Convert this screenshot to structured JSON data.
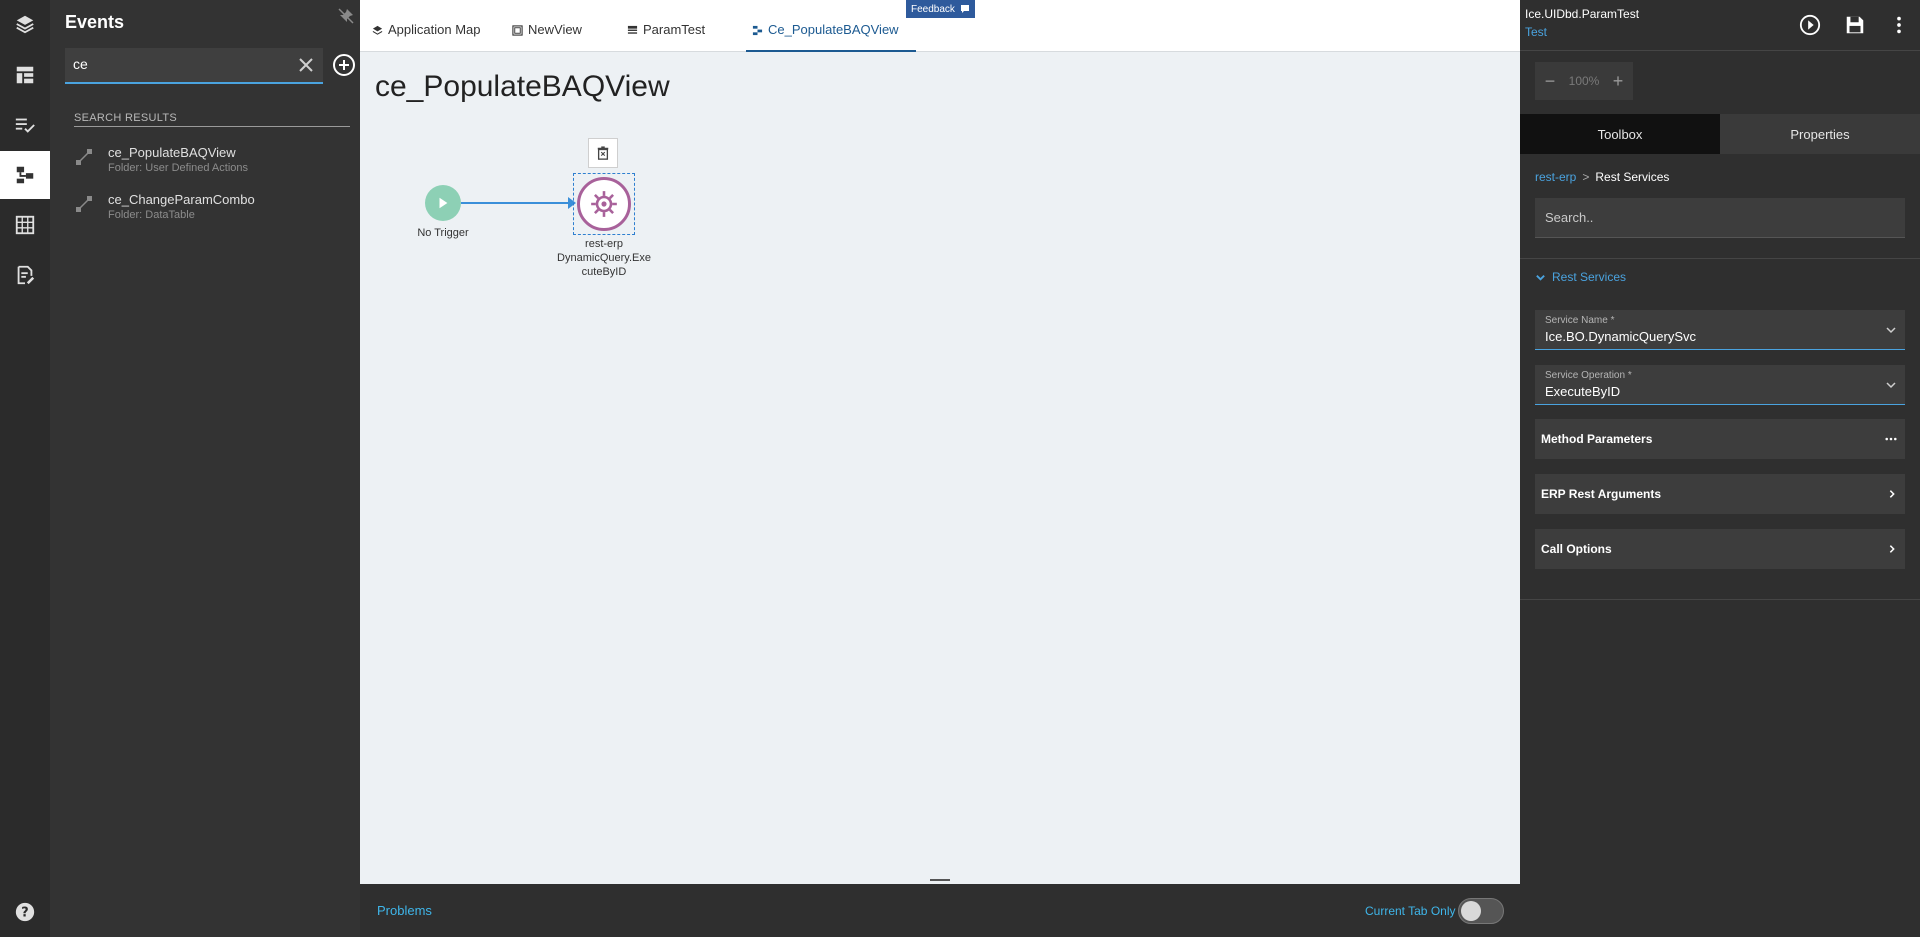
{
  "events_panel": {
    "title": "Events",
    "search": {
      "value": "ce",
      "placeholder": ""
    },
    "results_header": "SEARCH RESULTS",
    "results": [
      {
        "name": "ce_PopulateBAQView",
        "folder": "Folder: User Defined Actions"
      },
      {
        "name": "ce_ChangeParamCombo",
        "folder": "Folder: DataTable"
      }
    ]
  },
  "tabs": [
    {
      "label": "Application Map",
      "icon": "layers-icon",
      "active": false
    },
    {
      "label": "NewView",
      "icon": "view-icon",
      "active": false
    },
    {
      "label": "ParamTest",
      "icon": "table-icon",
      "active": false
    },
    {
      "label": "Ce_PopulateBAQView",
      "icon": "event-flow-icon",
      "active": true
    }
  ],
  "feedback_label": "Feedback",
  "canvas": {
    "title": "ce_PopulateBAQView",
    "trigger_label": "No Trigger",
    "node_label_line1": "rest-erp",
    "node_label_line2": "DynamicQuery.Exe",
    "node_label_line3": "cuteByID"
  },
  "bottom_bar": {
    "problems_label": "Problems",
    "current_tab_label": "Current Tab Only",
    "current_tab_only": false
  },
  "right_panel": {
    "app_name": "Ice.UIDbd.ParamTest",
    "env": "Test",
    "zoom": {
      "value": "100%",
      "minus": "−",
      "plus": "+"
    },
    "tabs": [
      {
        "label": "Toolbox",
        "active": true
      },
      {
        "label": "Properties",
        "active": false
      }
    ],
    "breadcrumb": {
      "parent": "rest-erp",
      "separator": ">",
      "current": "Rest Services"
    },
    "search_placeholder": "Search..",
    "section_title": "Rest Services",
    "fields": [
      {
        "label": "Service Name *",
        "value": "Ice.BO.DynamicQuerySvc"
      },
      {
        "label": "Service Operation *",
        "value": "ExecuteByID"
      }
    ],
    "sections": [
      {
        "label": "Method Parameters",
        "icon": "more-icon"
      },
      {
        "label": "ERP Rest Arguments",
        "icon": "chevron-right-icon"
      },
      {
        "label": "Call Options",
        "icon": "chevron-right-icon"
      }
    ]
  },
  "colors": {
    "accent": "#4aa3df",
    "active_tab": "#1c5a91",
    "trigger": "#8dd0b5",
    "node_border": "#a8619a",
    "edge": "#3a8fd9",
    "feedback_bg": "#2e5a9c"
  }
}
